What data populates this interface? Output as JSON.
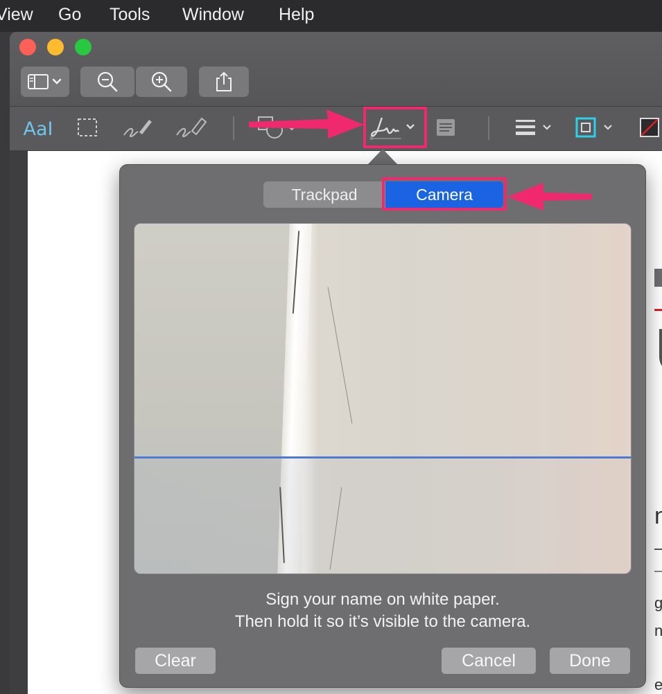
{
  "menubar": {
    "items": [
      "View",
      "Go",
      "Tools",
      "Window",
      "Help"
    ]
  },
  "window": {
    "toolbar": {
      "sidebar_icon": "sidebar-icon",
      "zoom_out_icon": "zoom-out-icon",
      "zoom_in_icon": "zoom-in-icon",
      "share_icon": "share-icon"
    },
    "markup_tools": {
      "text_tool_label": "AaI",
      "selection": "rect-select-icon",
      "sketch": "sketch-icon",
      "draw": "draw-icon",
      "shapes": "shapes-icon",
      "sign": "signature-icon",
      "note": "note-icon",
      "line_style": "line-style-icon",
      "border_color": "border-color-icon",
      "fill_color": "fill-color-icon"
    }
  },
  "document_snippets": {
    "big_letter": "U",
    "text1": "nv",
    "text2": "gra",
    "text3": "nni",
    "text4": "er"
  },
  "signature_popover": {
    "tabs": [
      {
        "label": "Trackpad",
        "selected": false
      },
      {
        "label": "Camera",
        "selected": true
      }
    ],
    "instruction_line1": "Sign your name on white paper.",
    "instruction_line2": "Then hold it so it’s visible to the camera.",
    "buttons": {
      "clear": "Clear",
      "cancel": "Cancel",
      "done": "Done"
    }
  },
  "colors": {
    "highlight": "#f0286e",
    "selected_tab": "#1a64e4",
    "guideline": "#4a7ad6",
    "border_color_swatch": "#28d2e8"
  }
}
